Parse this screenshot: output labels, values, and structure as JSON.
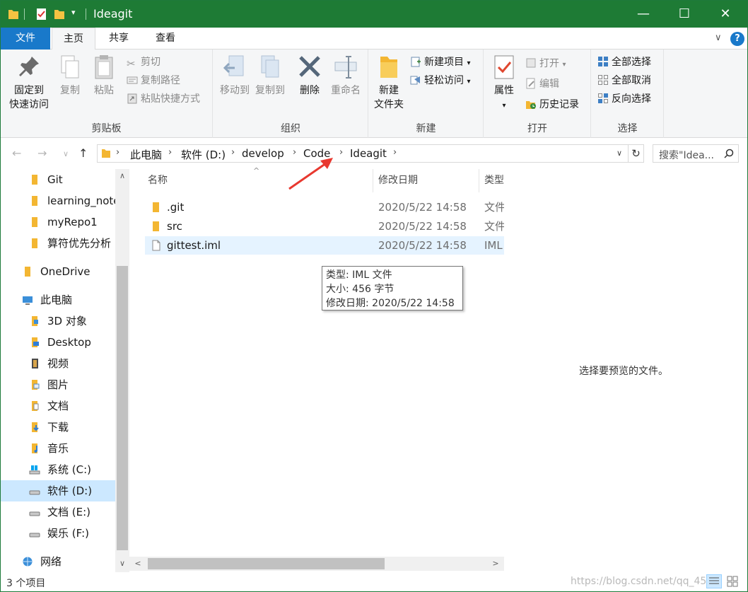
{
  "window": {
    "title": "Ideagit",
    "minimize": "—",
    "maximize": "☐",
    "close": "✕"
  },
  "ribbon_tabs": {
    "file": "文件",
    "home": "主页",
    "share": "共享",
    "view": "查看",
    "collapse": "∨",
    "help": "?"
  },
  "ribbon": {
    "clipboard": {
      "label": "剪贴板",
      "pin_line1": "固定到",
      "pin_line2": "快速访问",
      "copy": "复制",
      "paste": "粘贴",
      "cut": "剪切",
      "copy_path": "复制路径",
      "paste_shortcut": "粘贴快捷方式"
    },
    "organize": {
      "label": "组织",
      "move_to": "移动到",
      "copy_to": "复制到",
      "delete": "删除",
      "rename": "重命名"
    },
    "new": {
      "label": "新建",
      "new_folder_line1": "新建",
      "new_folder_line2": "文件夹",
      "new_item": "新建项目",
      "easy_access": "轻松访问"
    },
    "open": {
      "label": "打开",
      "properties": "属性",
      "open": "打开",
      "edit": "编辑",
      "history": "历史记录"
    },
    "select": {
      "label": "选择",
      "select_all": "全部选择",
      "select_none": "全部取消",
      "invert": "反向选择"
    }
  },
  "address": {
    "crumbs": [
      "此电脑",
      "软件 (D:)",
      "develop",
      "Code",
      "Ideagit"
    ],
    "search_placeholder": "搜索\"Idea..."
  },
  "nav": [
    {
      "label": "Git",
      "icon": "folder-icon"
    },
    {
      "label": "learning_note",
      "icon": "folder-icon"
    },
    {
      "label": "myRepo1",
      "icon": "folder-icon"
    },
    {
      "label": "算符优先分析",
      "icon": "folder-icon"
    },
    {
      "label": "OneDrive",
      "icon": "onedrive-icon"
    },
    {
      "label": "此电脑",
      "icon": "computer-icon"
    },
    {
      "label": "3D 对象",
      "icon": "3d-objects-icon"
    },
    {
      "label": "Desktop",
      "icon": "desktop-icon"
    },
    {
      "label": "视频",
      "icon": "video-icon"
    },
    {
      "label": "图片",
      "icon": "pictures-icon"
    },
    {
      "label": "文档",
      "icon": "documents-icon"
    },
    {
      "label": "下载",
      "icon": "downloads-icon"
    },
    {
      "label": "音乐",
      "icon": "music-icon"
    },
    {
      "label": "系统 (C:)",
      "icon": "system-drive-icon"
    },
    {
      "label": "软件 (D:)",
      "icon": "drive-icon"
    },
    {
      "label": "文档 (E:)",
      "icon": "drive-icon"
    },
    {
      "label": "娱乐 (F:)",
      "icon": "drive-icon"
    },
    {
      "label": "网络",
      "icon": "network-icon"
    }
  ],
  "columns": {
    "name": "名称",
    "modified": "修改日期",
    "type": "类型"
  },
  "files": [
    {
      "name": ".git",
      "modified": "2020/5/22 14:58",
      "type": "文件",
      "icon": "folder-icon"
    },
    {
      "name": "src",
      "modified": "2020/5/22 14:58",
      "type": "文件",
      "icon": "folder-icon"
    },
    {
      "name": "gittest.iml",
      "modified": "2020/5/22 14:58",
      "type": "IML",
      "icon": "file-icon"
    }
  ],
  "tooltip": {
    "type_line": "类型: IML 文件",
    "size_line": "大小: 456 字节",
    "date_line": "修改日期: 2020/5/22 14:58"
  },
  "preview": {
    "message": "选择要预览的文件。"
  },
  "status": {
    "count": "3 个项目",
    "watermark": "https://blog.csdn.net/qq_45"
  },
  "colors": {
    "titlebar": "#1e7b35",
    "file_tab": "#1979ca",
    "selection": "#cce8ff",
    "hover": "#e5f3ff",
    "annotation_arrow": "#e8382f"
  }
}
